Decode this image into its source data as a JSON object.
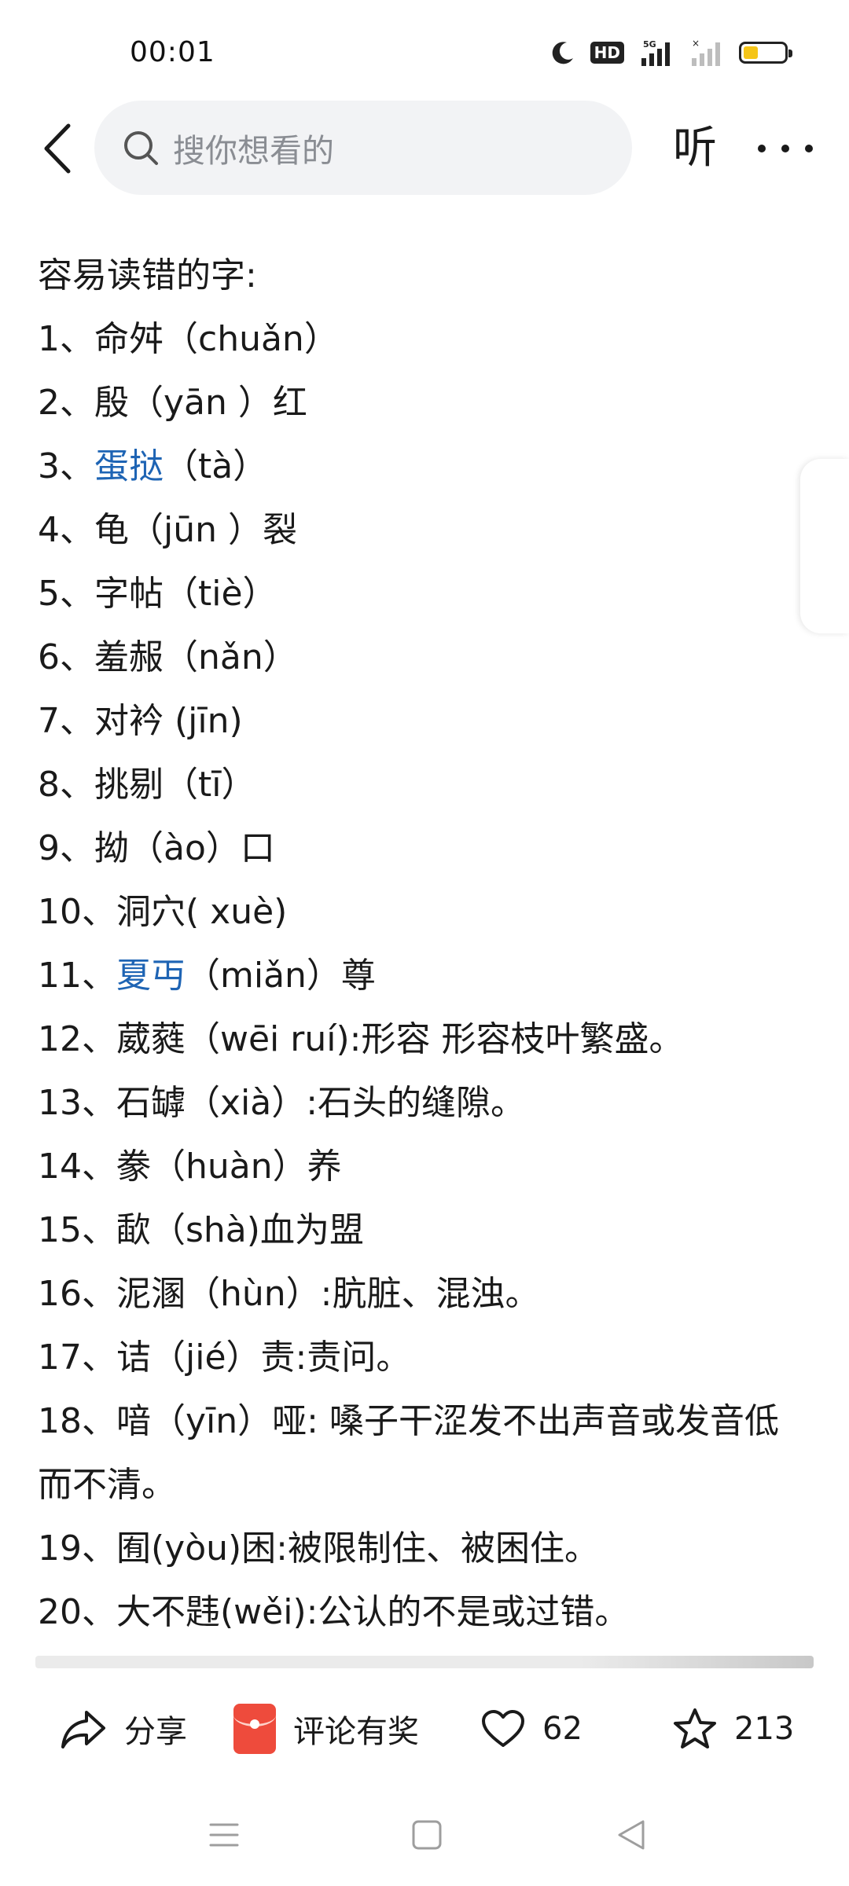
{
  "status_bar": {
    "time": "00:01",
    "hd_badge": "HD",
    "network": "5G",
    "battery_level_percent": 35
  },
  "top_nav": {
    "search_placeholder": "搜你想看的",
    "listen_label": "听"
  },
  "article": {
    "heading": "容易读错的字:",
    "items": [
      {
        "num": "1、",
        "pre": "",
        "link": "",
        "post": "命舛（chuǎn）"
      },
      {
        "num": "2、",
        "pre": "",
        "link": "",
        "post": "殷（yān ）红"
      },
      {
        "num": "3、",
        "pre": "",
        "link": "蛋挞",
        "post": "（tà）"
      },
      {
        "num": "4、",
        "pre": "",
        "link": "",
        "post": "龟（jūn ）裂"
      },
      {
        "num": "5、",
        "pre": "",
        "link": "",
        "post": "字帖（tiè）"
      },
      {
        "num": "6、",
        "pre": "",
        "link": "",
        "post": "羞赧（nǎn）"
      },
      {
        "num": "7、",
        "pre": "",
        "link": "",
        "post": "对衿 (jīn)"
      },
      {
        "num": "8、",
        "pre": "",
        "link": "",
        "post": "挑剔（tī）"
      },
      {
        "num": "9、",
        "pre": "",
        "link": "",
        "post": "拗（ào）口"
      },
      {
        "num": "10、",
        "pre": "",
        "link": "",
        "post": "洞穴( xuè)"
      },
      {
        "num": "11、",
        "pre": "",
        "link": "夏丏",
        "post": "（miǎn）尊"
      },
      {
        "num": "12、",
        "pre": "",
        "link": "",
        "post": "葳蕤（wēi ruí):形容 形容枝叶繁盛。"
      },
      {
        "num": "13、",
        "pre": "",
        "link": "",
        "post": "石罅（xià）:石头的缝隙。"
      },
      {
        "num": "14、",
        "pre": "",
        "link": "",
        "post": "豢（huàn）养"
      },
      {
        "num": "15、",
        "pre": "",
        "link": "",
        "post": "歃（shà)血为盟"
      },
      {
        "num": "16、",
        "pre": "",
        "link": "",
        "post": "泥溷（hùn）:肮脏、混浊。"
      },
      {
        "num": "17、",
        "pre": "",
        "link": "",
        "post": "诘（jié）责:责问。"
      },
      {
        "num": "18、",
        "pre": "",
        "link": "",
        "post": "喑（yīn）哑: 嗓子干涩发不出声音或发音低而不清。"
      },
      {
        "num": "19、",
        "pre": "",
        "link": "",
        "post": "囿(yòu)困:被限制住、被困住。"
      },
      {
        "num": "20、",
        "pre": "",
        "link": "",
        "post": "大不韪(wěi):公认的不是或过错。"
      }
    ]
  },
  "action_bar": {
    "share_label": "分享",
    "comment_label": "评论有奖",
    "like_count": "62",
    "favorite_count": "213"
  },
  "colors": {
    "link": "#1e64b4",
    "search_bg": "#f2f3f5",
    "red_envelope": "#ee4b3c",
    "battery": "#f5c518"
  }
}
